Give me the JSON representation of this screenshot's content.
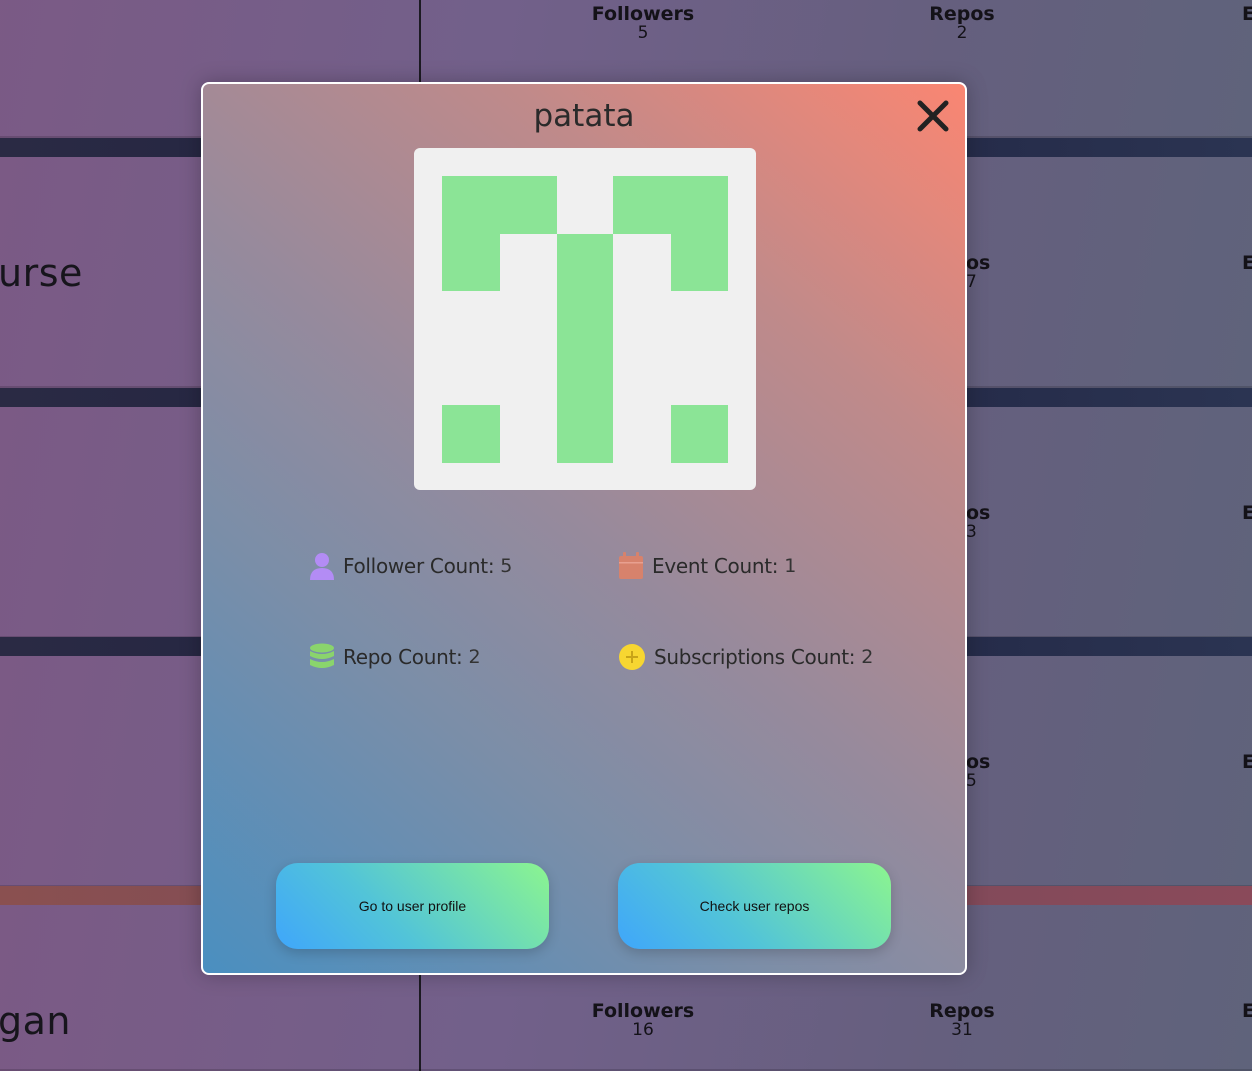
{
  "background": {
    "top_stats": {
      "followers_label": "Followers",
      "followers_value": "5",
      "repos_label": "Repos",
      "repos_value": "2",
      "events_label": "E"
    },
    "rows": [
      {
        "name": "",
        "repos_partial": "",
        "events_partial": "E"
      },
      {
        "name": "urse",
        "repos_partial": "os",
        "repos_value_partial": "7",
        "events_partial": "E"
      },
      {
        "name": "",
        "repos_partial": "os",
        "repos_value_partial": "3",
        "events_partial": "E"
      },
      {
        "name": "",
        "repos_partial": "os",
        "repos_value_partial": "5",
        "events_partial": "E"
      }
    ],
    "bottom_stats": {
      "name": "gan",
      "followers_label": "Followers",
      "followers_value": "16",
      "repos_label": "Repos",
      "repos_value": "31",
      "events_label": "E"
    }
  },
  "modal": {
    "title": "patata",
    "close_icon": "close-icon",
    "avatar_color": "#8be496",
    "stats": {
      "followers": {
        "label": "Follower Count:",
        "value": "5",
        "icon": "user-icon",
        "color": "#b38cf5"
      },
      "events": {
        "label": "Event Count:",
        "value": "1",
        "icon": "calendar-icon",
        "color": "#d7826c"
      },
      "repos": {
        "label": "Repo Count:",
        "value": "2",
        "icon": "database-icon",
        "color": "#8ad46c"
      },
      "subscriptions": {
        "label": "Subscriptions Count:",
        "value": "2",
        "icon": "plus-circle-icon",
        "color": "#f7d631"
      }
    },
    "buttons": {
      "profile": "Go to user profile",
      "repos": "Check user repos"
    }
  }
}
